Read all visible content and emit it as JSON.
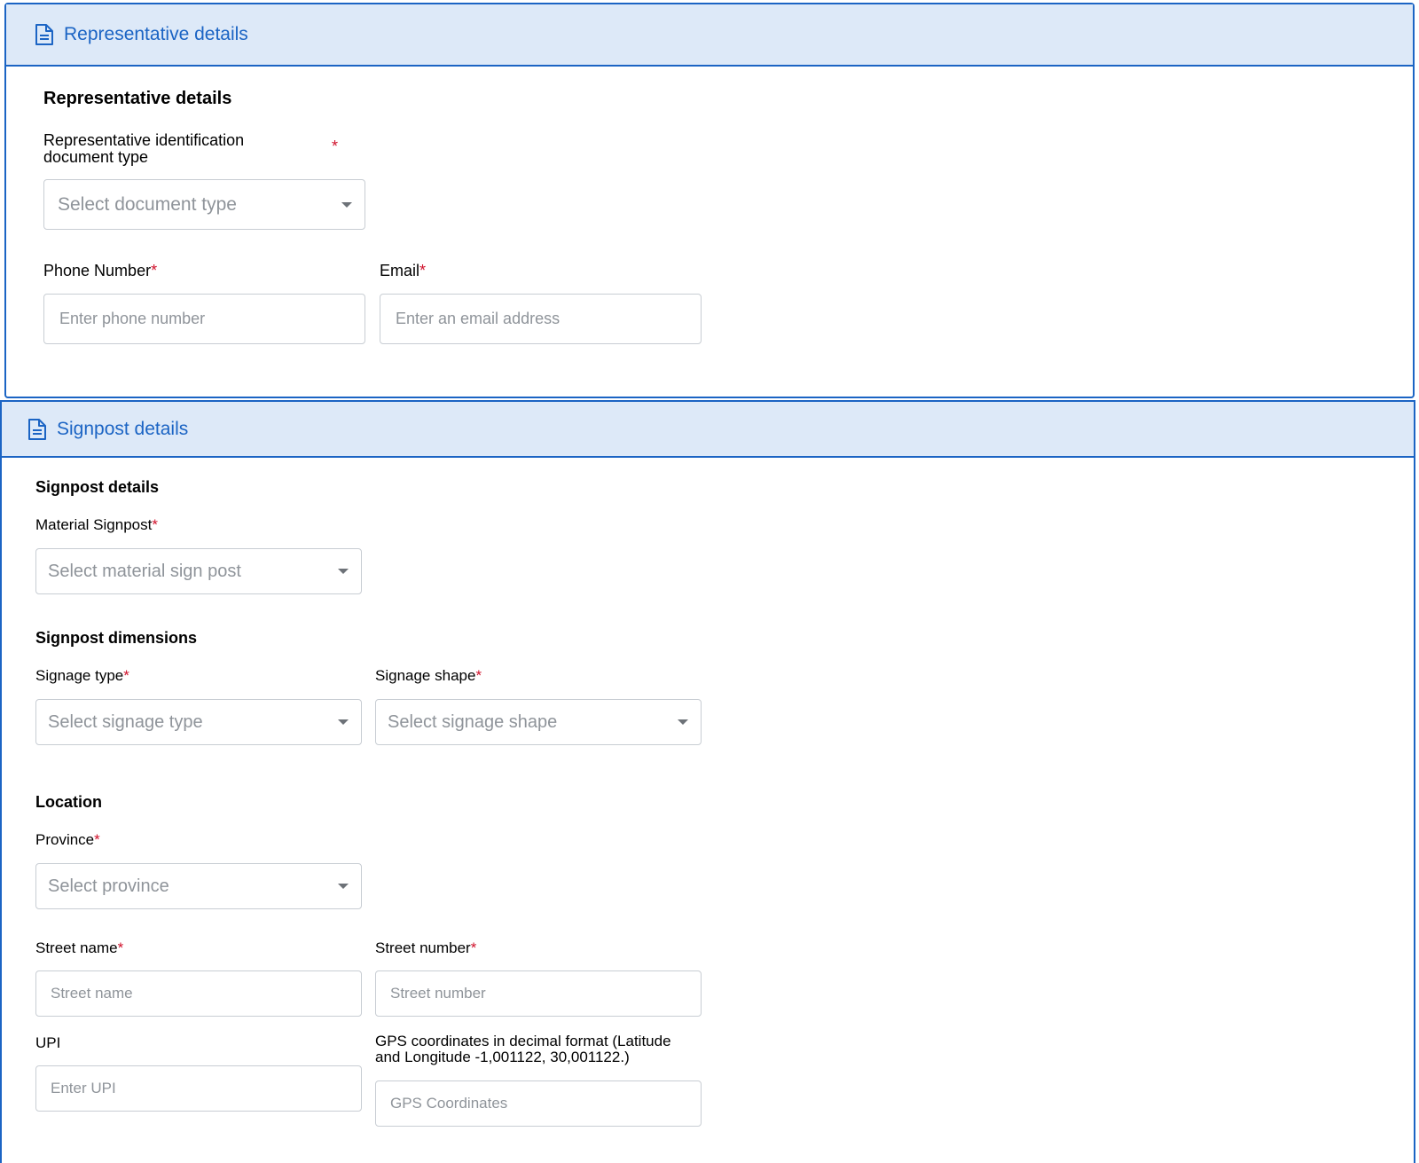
{
  "representative": {
    "header": "Representative details",
    "section_title": "Representative details",
    "doc_type_label": "Representative identification document type",
    "doc_type_placeholder": "Select document type",
    "phone_label": "Phone Number",
    "phone_placeholder": "Enter phone number",
    "email_label": "Email",
    "email_placeholder": "Enter an email address"
  },
  "signpost": {
    "header": "Signpost details",
    "section_title": "Signpost details",
    "material_label": "Material Signpost",
    "material_placeholder": "Select material sign post",
    "dimensions_title": "Signpost dimensions",
    "signage_type_label": "Signage type",
    "signage_type_placeholder": "Select signage type",
    "signage_shape_label": "Signage shape",
    "signage_shape_placeholder": "Select signage shape"
  },
  "location": {
    "section_title": "Location",
    "province_label": "Province",
    "province_placeholder": "Select province",
    "street_name_label": "Street name",
    "street_name_placeholder": "Street name",
    "street_number_label": "Street number",
    "street_number_placeholder": "Street number",
    "upi_label": "UPI",
    "upi_placeholder": "Enter UPI",
    "gps_label_line1": "GPS coordinates in decimal format (Latitude",
    "gps_label_line2": "and Longitude -1,001122, 30,001122.)",
    "gps_placeholder": "GPS Coordinates"
  },
  "required_marker": "*",
  "icons": {
    "header_icon": "document-icon",
    "dropdown_icon": "caret-down-icon"
  },
  "colors": {
    "accent": "#1b64c4",
    "header_bg": "#dde9f8",
    "required": "#d0112b",
    "placeholder": "#8f949a",
    "border": "#c8cdd3"
  }
}
